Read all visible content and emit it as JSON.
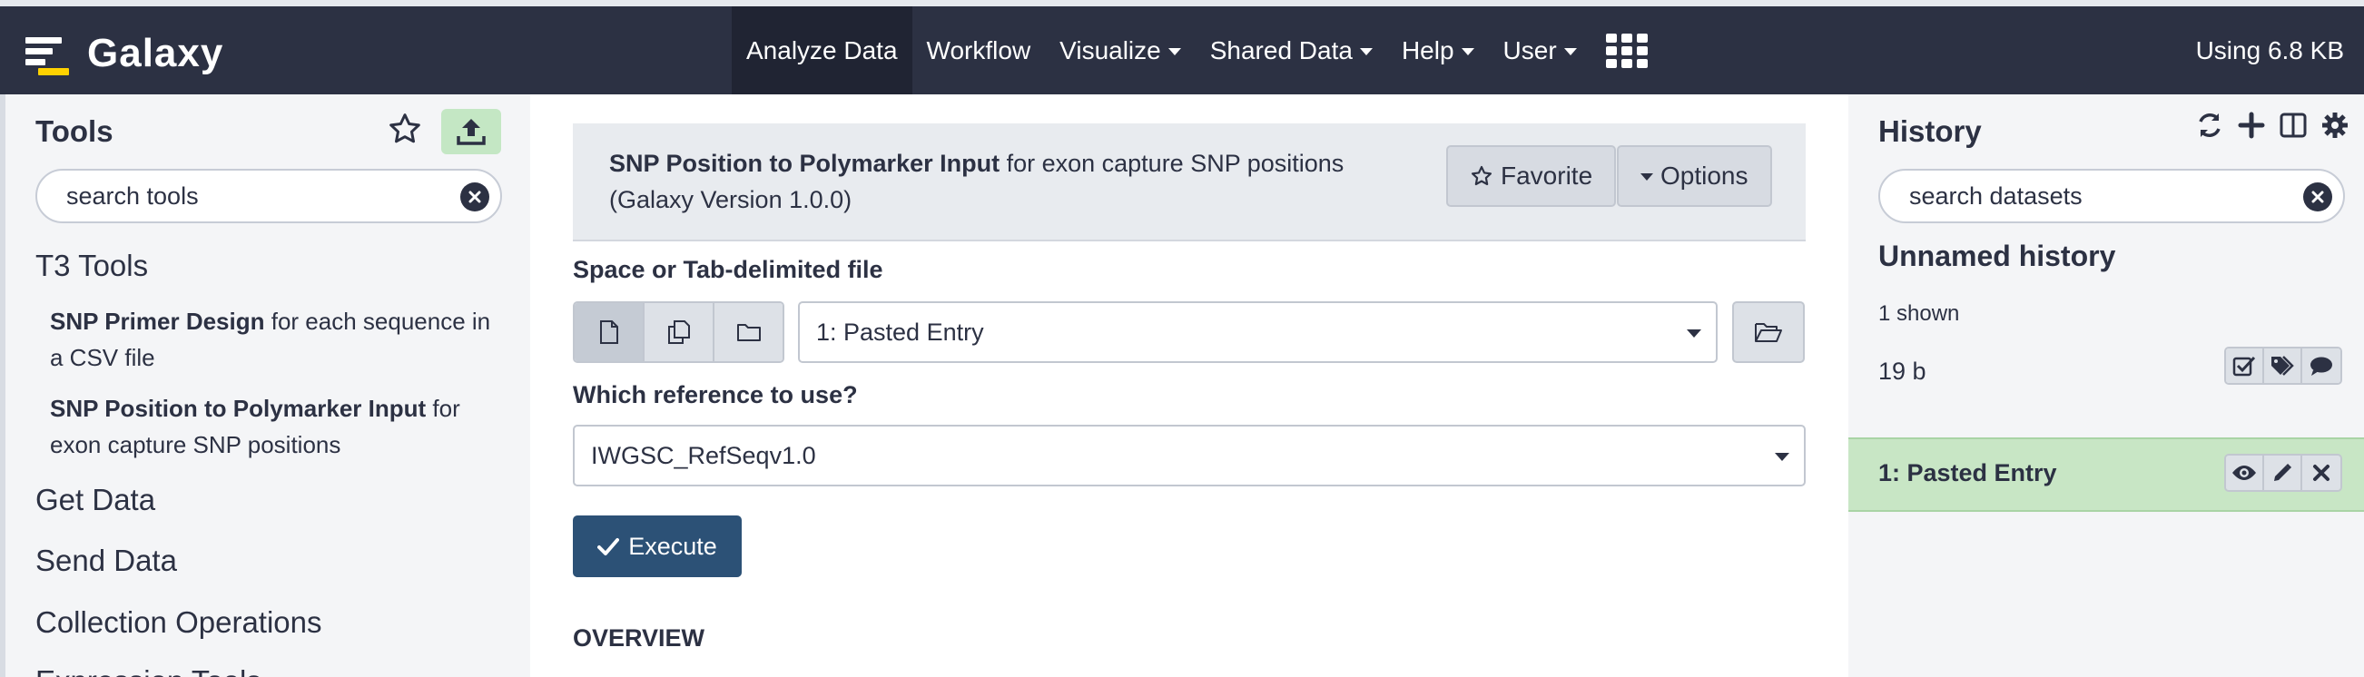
{
  "brand": {
    "title": "Galaxy"
  },
  "nav": {
    "items": [
      {
        "label": "Analyze Data",
        "active": true,
        "dropdown": false
      },
      {
        "label": "Workflow",
        "active": false,
        "dropdown": false
      },
      {
        "label": "Visualize",
        "active": false,
        "dropdown": true
      },
      {
        "label": "Shared Data",
        "active": false,
        "dropdown": true
      },
      {
        "label": "Help",
        "active": false,
        "dropdown": true
      },
      {
        "label": "User",
        "active": false,
        "dropdown": true
      }
    ],
    "apps_icon": "grid-icon",
    "quota": "Using 6.8 KB"
  },
  "tools": {
    "title": "Tools",
    "search_placeholder": "search tools",
    "sections": [
      {
        "label": "T3 Tools"
      },
      {
        "label": "Get Data"
      },
      {
        "label": "Send Data"
      },
      {
        "label": "Collection Operations"
      },
      {
        "label": "Expression Tools"
      }
    ],
    "items": [
      {
        "name": "SNP Primer Design",
        "desc": " for each sequence in a CSV file"
      },
      {
        "name": "SNP Position to Polymarker Input",
        "desc": " for exon capture SNP positions"
      }
    ]
  },
  "form": {
    "tool_name": "SNP Position to Polymarker Input",
    "tool_desc": " for exon capture SNP positions",
    "tool_version": "(Galaxy Version 1.0.0)",
    "favorite_label": "Favorite",
    "options_label": "Options",
    "input_label": "Space or Tab-delimited file",
    "input_value": "1: Pasted Entry",
    "reference_label": "Which reference to use?",
    "reference_value": "IWGSC_RefSeqv1.0",
    "execute_label": "Execute",
    "overview_label": "OVERVIEW"
  },
  "history": {
    "title": "History",
    "search_placeholder": "search datasets",
    "name": "Unnamed history",
    "shown": "1 shown",
    "size": "19 b",
    "dataset": {
      "title": "1: Pasted Entry"
    }
  },
  "colors": {
    "masthead": "#2c3143",
    "active_nav": "#202433",
    "execute": "#2c5176",
    "dataset_ok": "#c8e6c5",
    "upload": "#c4e7c4"
  }
}
